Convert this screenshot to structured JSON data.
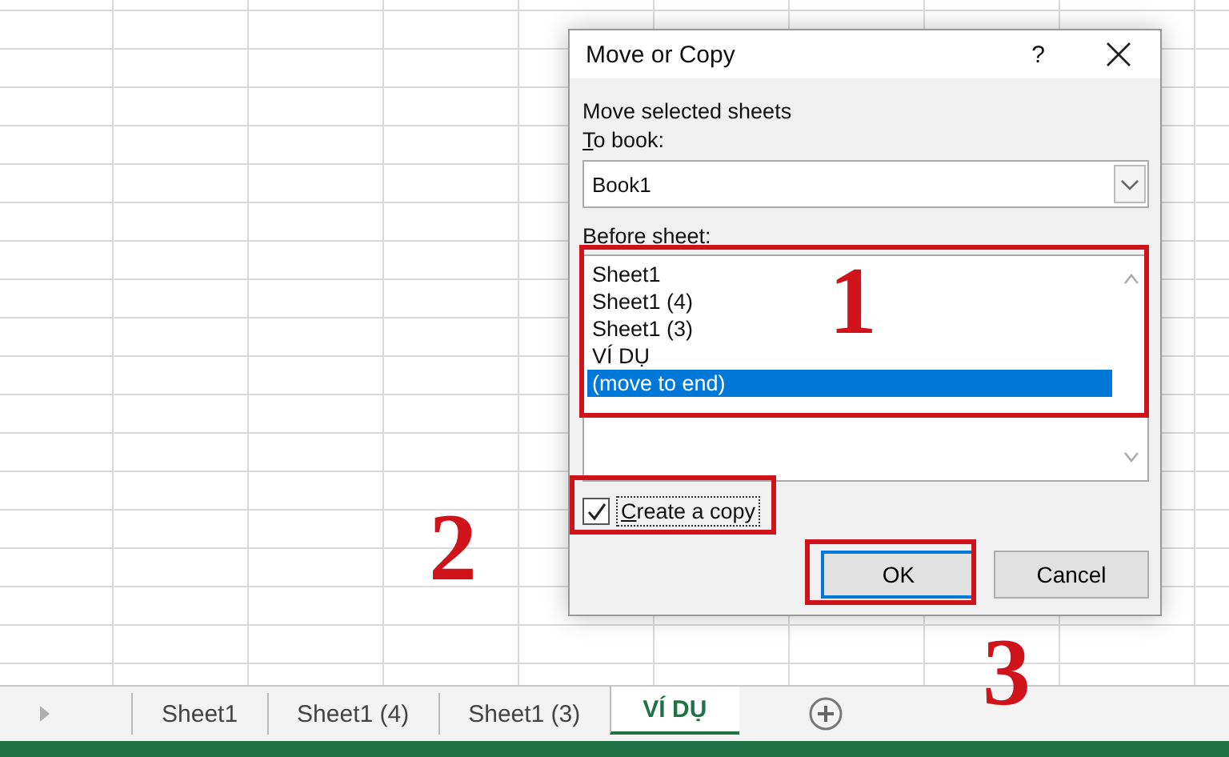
{
  "dialog": {
    "title": "Move or Copy",
    "help": "?",
    "heading": "Move selected sheets",
    "to_book_label": "To book:",
    "to_book": "Book1",
    "before_label": "Before sheet:",
    "sheets": [
      {
        "label": "Sheet1",
        "selected": false
      },
      {
        "label": "Sheet1 (4)",
        "selected": false
      },
      {
        "label": "Sheet1 (3)",
        "selected": false
      },
      {
        "label": "VÍ DỤ",
        "selected": false
      },
      {
        "label": "(move to end)",
        "selected": true
      }
    ],
    "create_copy": {
      "label": "Create a copy",
      "checked": true
    },
    "buttons": [
      {
        "label": "OK",
        "default": true
      },
      {
        "label": "Cancel",
        "default": false
      }
    ]
  },
  "sheet_tabs": [
    {
      "label": "Sheet1",
      "selected": false
    },
    {
      "label": "Sheet1 (4)",
      "selected": false
    },
    {
      "label": "Sheet1 (3)",
      "selected": false
    },
    {
      "label": "VÍ DỤ",
      "selected": true
    }
  ],
  "annotations": [
    {
      "number": "1"
    },
    {
      "number": "2"
    },
    {
      "number": "3"
    }
  ]
}
